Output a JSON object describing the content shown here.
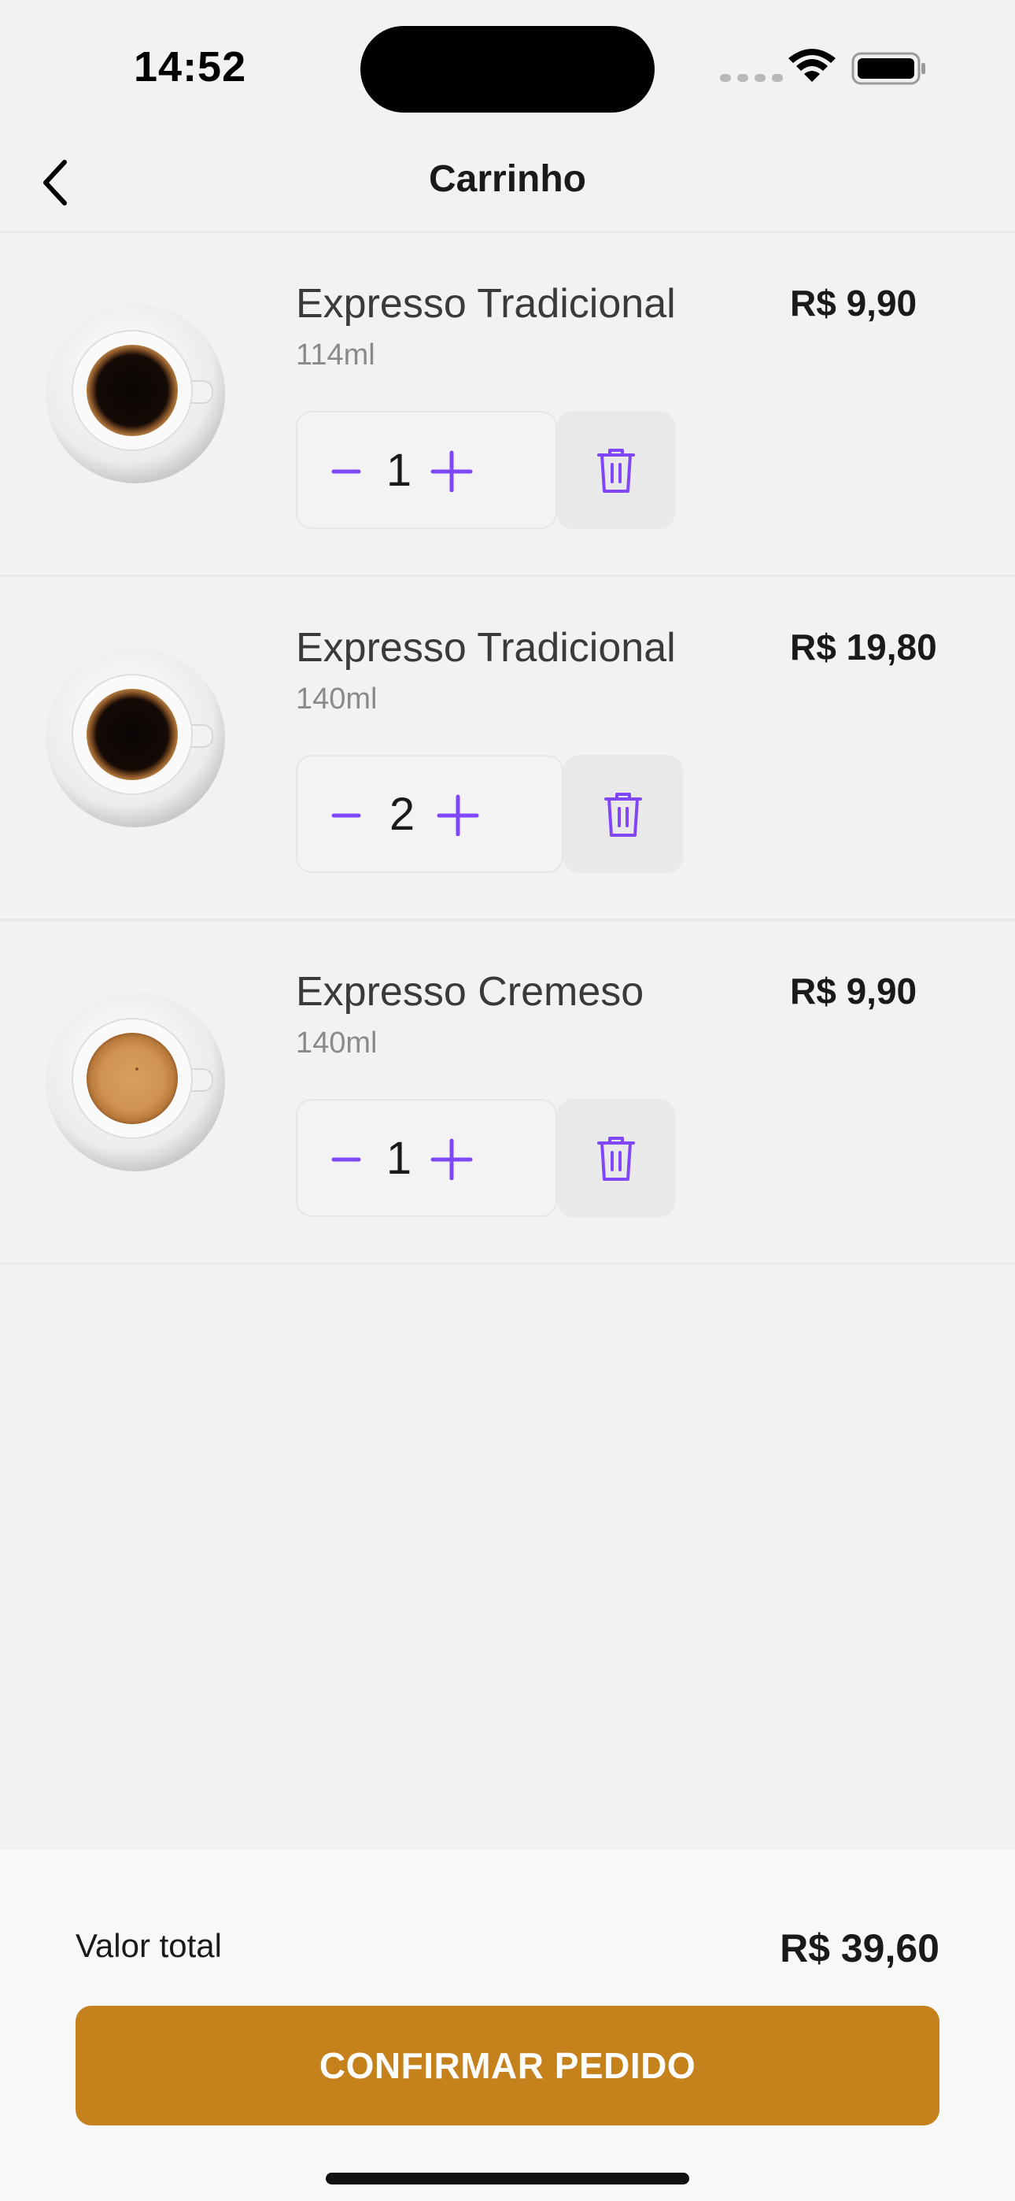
{
  "status_bar": {
    "time": "14:52"
  },
  "header": {
    "title": "Carrinho",
    "back_icon": "chevron-left-icon"
  },
  "cart": {
    "items": [
      {
        "name": "Expresso Tradicional",
        "size": "114ml",
        "price": "R$ 9,90",
        "quantity": "1",
        "coffee_style": "black"
      },
      {
        "name": "Expresso Tradicional",
        "size": "140ml",
        "price": "R$ 19,80",
        "quantity": "2",
        "coffee_style": "black"
      },
      {
        "name": "Expresso Cremeso",
        "size": "140ml",
        "price": "R$ 9,90",
        "quantity": "1",
        "coffee_style": "cream"
      }
    ]
  },
  "footer": {
    "total_label": "Valor total",
    "total_value": "R$ 39,60",
    "confirm_label": "CONFIRMAR PEDIDO"
  },
  "colors": {
    "accent": "#8047F8",
    "confirm": "#C5811B",
    "background": "#F2F2F2"
  }
}
